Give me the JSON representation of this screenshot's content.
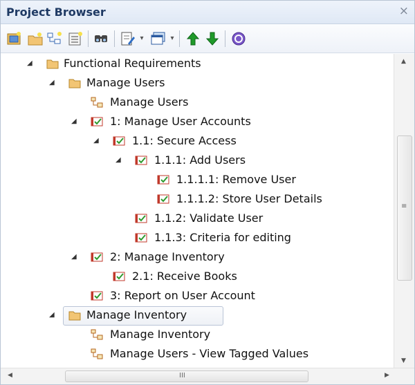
{
  "panel": {
    "title": "Project Browser",
    "close_glyph": "×"
  },
  "toolbar": {
    "buttons": [
      {
        "name": "new-model-icon"
      },
      {
        "name": "new-package-icon"
      },
      {
        "name": "new-diagram-icon"
      },
      {
        "name": "new-element-icon"
      },
      {
        "name": "find-icon"
      },
      {
        "name": "document-icon"
      },
      {
        "name": "window-icon"
      },
      {
        "name": "move-up-icon"
      },
      {
        "name": "move-down-icon"
      },
      {
        "name": "help-icon"
      }
    ]
  },
  "tree": {
    "rows": [
      {
        "label": "Functional Requirements",
        "type": "folder",
        "expanded": true
      },
      {
        "label": "Manage Users",
        "type": "folder",
        "expanded": true
      },
      {
        "label": "Manage Users",
        "type": "diagram"
      },
      {
        "label": "1: Manage User Accounts",
        "type": "requirement",
        "expanded": true
      },
      {
        "label": "1.1: Secure Access",
        "type": "requirement",
        "expanded": true
      },
      {
        "label": "1.1.1: Add Users",
        "type": "requirement",
        "expanded": true
      },
      {
        "label": "1.1.1.1: Remove User",
        "type": "requirement"
      },
      {
        "label": "1.1.1.2: Store User Details",
        "type": "requirement"
      },
      {
        "label": "1.1.2: Validate User",
        "type": "requirement"
      },
      {
        "label": "1.1.3: Criteria for editing",
        "type": "requirement"
      },
      {
        "label": "2: Manage Inventory",
        "type": "requirement",
        "expanded": true
      },
      {
        "label": "2.1: Receive Books",
        "type": "requirement"
      },
      {
        "label": "3: Report on User Account",
        "type": "requirement"
      },
      {
        "label": "Manage Inventory",
        "type": "folder",
        "expanded": true,
        "selected": true
      },
      {
        "label": "Manage Inventory",
        "type": "diagram"
      },
      {
        "label": "Manage Users - View Tagged Values",
        "type": "diagram"
      }
    ]
  },
  "colors": {
    "accent": "#1f3a64",
    "folder": "#f2c574",
    "requirement_check": "#2e9a2e",
    "requirement_box": "#c0392b"
  },
  "scrollbar": {
    "grip_glyph": "≡",
    "h_grip_glyph": "III"
  }
}
